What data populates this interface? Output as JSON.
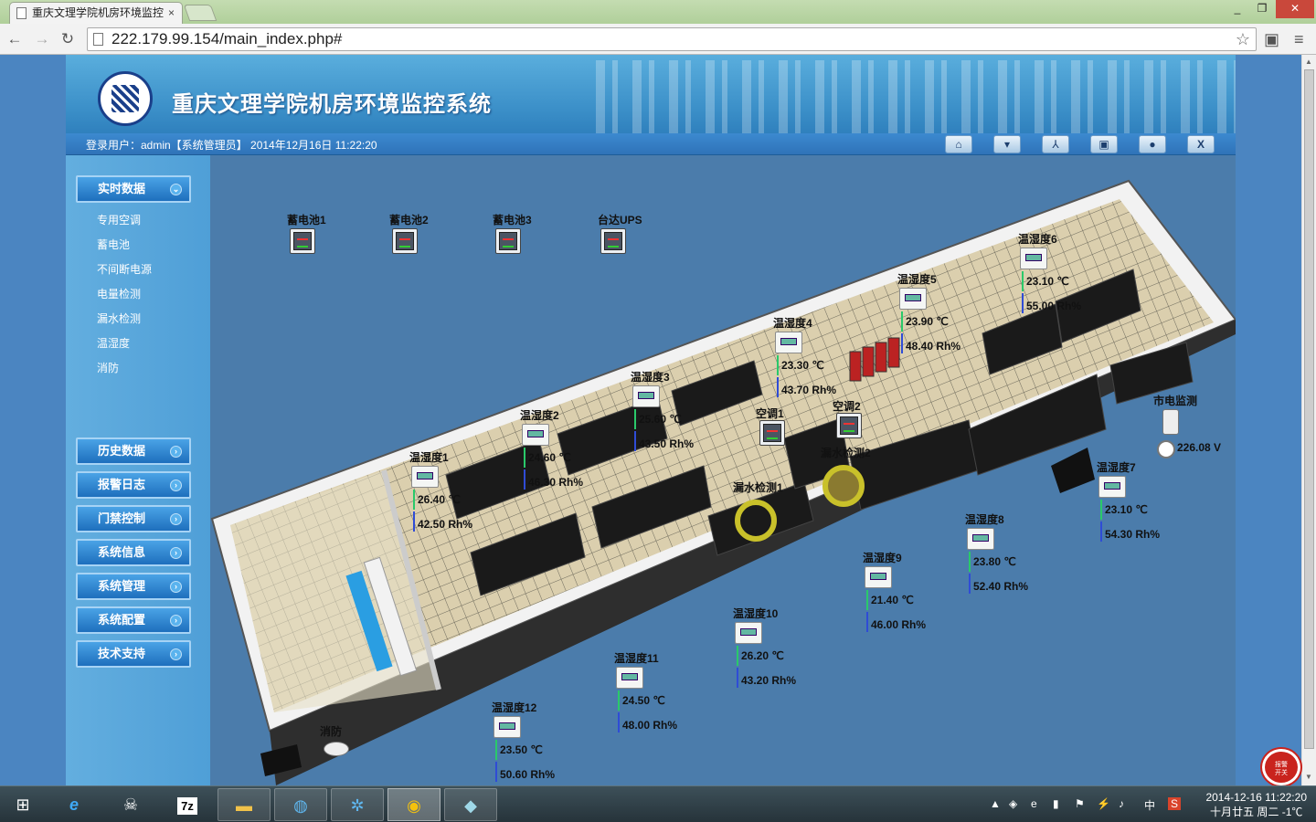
{
  "browser": {
    "tab_title": "重庆文理学院机房环境监控",
    "tab_close": "×",
    "url": "222.179.99.154/main_index.php#",
    "window_controls": [
      "_",
      "❐",
      "✕"
    ]
  },
  "header": {
    "title": "重庆文理学院机房环境监控系统",
    "user_line": "登录用户：admin【系统管理员】 2014年12月16日 11:22:20"
  },
  "top_buttons": [
    {
      "icon": "home-icon"
    },
    {
      "icon": "shirt-icon"
    },
    {
      "icon": "tool-icon"
    },
    {
      "icon": "screen-icon"
    },
    {
      "icon": "user-icon"
    },
    {
      "icon": "exit-icon",
      "label": "X"
    }
  ],
  "sidebar": {
    "realtime": "实时数据",
    "sub_items": [
      "专用空调",
      "蓄电池",
      "不间断电源",
      "电量检测",
      "漏水检测",
      "温湿度",
      "消防"
    ],
    "menu": [
      "历史数据",
      "报警日志",
      "门禁控制",
      "系统信息",
      "系统管理",
      "系统配置",
      "技术支持"
    ]
  },
  "devices": {
    "battery1": "蓄电池1",
    "battery2": "蓄电池2",
    "battery3": "蓄电池3",
    "ups": "台达UPS",
    "ac1": "空调1",
    "ac2": "空调2",
    "leak1": "漏水检测1",
    "leak2": "漏水检测2",
    "power": "市电监测",
    "power_value": "226.08 V",
    "fire": "消防"
  },
  "sensors": [
    {
      "name": "温湿度1",
      "temp": "26.40 ℃",
      "hum": "42.50 Rh%"
    },
    {
      "name": "温湿度2",
      "temp": "24.60 ℃",
      "hum": "46.30 Rh%"
    },
    {
      "name": "温湿度3",
      "temp": "25.60 ℃",
      "hum": "43.50 Rh%"
    },
    {
      "name": "温湿度4",
      "temp": "23.30 ℃",
      "hum": "43.70 Rh%"
    },
    {
      "name": "温湿度5",
      "temp": "23.90 ℃",
      "hum": "48.40 Rh%"
    },
    {
      "name": "温湿度6",
      "temp": "23.10 ℃",
      "hum": "55.00 Rh%"
    },
    {
      "name": "温湿度7",
      "temp": "23.10 ℃",
      "hum": "54.30 Rh%"
    },
    {
      "name": "温湿度8",
      "temp": "23.80 ℃",
      "hum": "52.40 Rh%"
    },
    {
      "name": "温湿度9",
      "temp": "21.40 ℃",
      "hum": "46.00 Rh%"
    },
    {
      "name": "温湿度10",
      "temp": "26.20 ℃",
      "hum": "43.20 Rh%"
    },
    {
      "name": "温湿度11",
      "temp": "24.50 ℃",
      "hum": "48.00 Rh%"
    },
    {
      "name": "温湿度12",
      "temp": "23.50 ℃",
      "hum": "50.60 Rh%"
    }
  ],
  "alarm_switch": "报警\n开关",
  "taskbar": {
    "clock_time": "2014-12-16  11:22:20",
    "clock_date": "十月廿五 周二 -1℃",
    "ime": "中"
  }
}
